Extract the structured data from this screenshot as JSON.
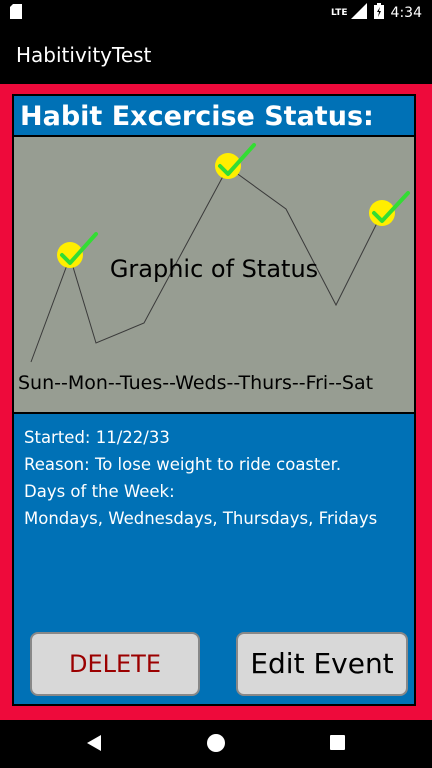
{
  "status_bar": {
    "network": "LTE",
    "time": "4:34"
  },
  "app_bar": {
    "title": "HabitivityTest"
  },
  "panel": {
    "title": "Habit Excercise Status:",
    "graph_caption": "Graphic of Status",
    "days_label": "Sun--Mon--Tues--Weds--Thurs--Fri--Sat"
  },
  "details": {
    "started": "Started: 11/22/33",
    "reason": "Reason: To lose weight to ride coaster.",
    "days_heading": "Days of the Week:",
    "days_list": "Mondays, Wednesdays, Thursdays, Fridays"
  },
  "buttons": {
    "delete_label": "DELETE",
    "edit_label": "Edit Event"
  },
  "colors": {
    "background_red": "#ee0a3b",
    "panel_blue": "#0071b6",
    "graph_gray": "#979d92",
    "delete_text": "#9b0000",
    "check_green": "#33dd33",
    "check_circle": "#ffee00"
  },
  "icons": [
    "sd-card-icon",
    "signal-icon",
    "battery-icon",
    "back-icon",
    "home-icon",
    "recents-icon",
    "checkmark-icon"
  ]
}
